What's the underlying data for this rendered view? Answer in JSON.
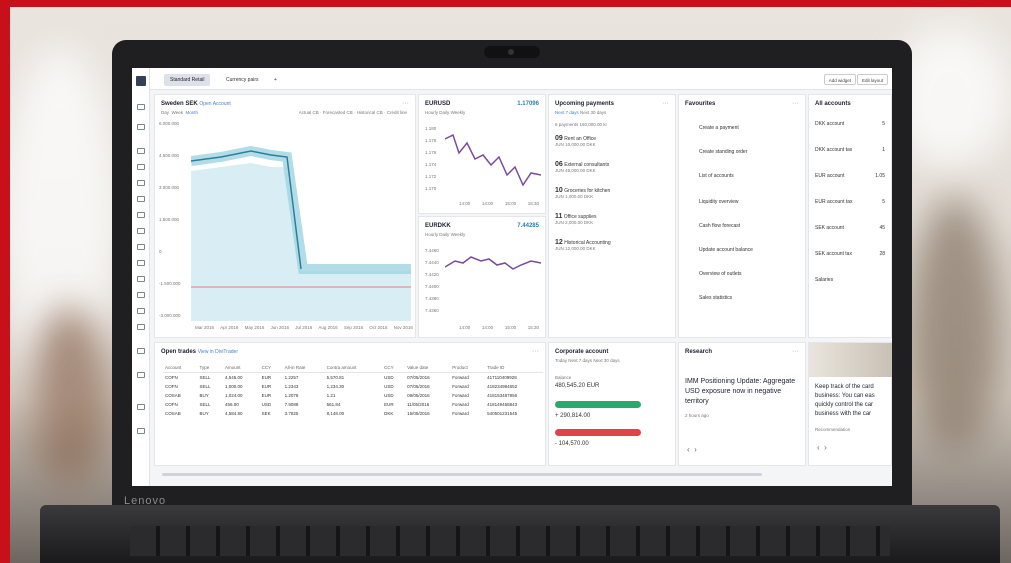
{
  "tabs": [
    {
      "label": "Standard Retail"
    },
    {
      "label": "Currency pairs"
    },
    {
      "label": "+"
    }
  ],
  "toolbar": {
    "add_widget": "Add widget",
    "edit_layout": "Edit layout"
  },
  "laptop": {
    "brand": "Lenovo"
  },
  "sweden": {
    "title": "Sweden SEK",
    "link": "Open Account",
    "tabs": [
      "Day",
      "Week",
      "Month"
    ],
    "legend": [
      "Actual CB",
      "Forecasted CB",
      "Historical CB",
      "Credit line"
    ],
    "y_ticks": [
      "6.000.000",
      "4.500.000",
      "3.000.000",
      "1.500.000",
      "0",
      "-1.500.000",
      "-3.000.000"
    ],
    "x_ticks": [
      "Mar 2016",
      "Apr 2016",
      "May 2016",
      "Jun 2016",
      "Jul 2016",
      "Aug 2016",
      "Sep 2016",
      "Oct 2016",
      "Nov 2016"
    ]
  },
  "eurusd": {
    "title": "EURUSD",
    "value": "1.17096",
    "tabs": [
      "Hourly",
      "Daily",
      "Weekly"
    ],
    "y_ticks": [
      "1.180",
      "1.178",
      "1.176",
      "1.174",
      "1.172",
      "1.170"
    ],
    "x_ticks": [
      "14:00",
      "14:00",
      "15:00",
      "15:30"
    ]
  },
  "eurdkk": {
    "title": "EURDKK",
    "value": "7.44285",
    "tabs": [
      "Hourly",
      "Daily",
      "Weekly"
    ],
    "y_ticks": [
      "7.4460",
      "7.4440",
      "7.4420",
      "7.4400",
      "7.4380",
      "7.4360"
    ],
    "x_ticks": [
      "14:00",
      "14:00",
      "15:00",
      "15:30"
    ]
  },
  "payments": {
    "title": "Upcoming payments",
    "tabs": [
      "Next 7 days",
      "Next 30 days"
    ],
    "summary": "6 payments   160,000.00 kr",
    "items": [
      {
        "day": "09",
        "month": "JUN",
        "name": "Rent an Office",
        "amount": "10,000.00 DKK"
      },
      {
        "day": "06",
        "month": "JUN",
        "name": "External consultants",
        "amount": "45,000.00 DKK"
      },
      {
        "day": "10",
        "month": "JUN",
        "name": "Groceries for kitchen",
        "amount": "1,000.00 DKK"
      },
      {
        "day": "11",
        "month": "JUN",
        "name": "Office supplies",
        "amount": "2,000.00 DKK"
      },
      {
        "day": "12",
        "month": "JUN",
        "name": "Historical Accounting",
        "amount": "12,000.00 DKK"
      }
    ]
  },
  "favourites": {
    "title": "Favourites",
    "items": [
      "Create a payment",
      "Create standing order",
      "List of accounts",
      "Liquidity overview",
      "Cash flow forecast",
      "Update account balance",
      "Overview of outlets",
      "Sales statistics"
    ]
  },
  "accounts": {
    "title": "All accounts",
    "items": [
      {
        "name": "DKK account",
        "amount": "5"
      },
      {
        "name": "DKK account tax",
        "amount": "1"
      },
      {
        "name": "EUR account",
        "amount": "1.05"
      },
      {
        "name": "EUR account tax",
        "amount": "5"
      },
      {
        "name": "SEK account",
        "amount": "45"
      },
      {
        "name": "SEK account tax",
        "amount": "28"
      },
      {
        "name": "Salaries",
        "amount": ""
      }
    ]
  },
  "trades": {
    "title": "Open trades",
    "link": "View in DiviTrader",
    "headers": [
      "Account",
      "Type",
      "Amount",
      "CCY",
      "All-in Rate",
      "Contra amount",
      "CCY",
      "Value date",
      "Product",
      "Trade ID"
    ],
    "rows": [
      [
        "COFN",
        "SELL",
        "4,545.00",
        "EUR",
        "1.2257",
        "5,570.81",
        "USD",
        "07/05/2016",
        "Forward",
        "417110409928"
      ],
      [
        "COFN",
        "SELL",
        "1,000.00",
        "EUR",
        "1.2343",
        "1,234.30",
        "USD",
        "07/05/2016",
        "Forward",
        "418234984652"
      ],
      [
        "COSAB",
        "BUY",
        "1,024.00",
        "EUR",
        "1.2078",
        "1.21",
        "USD",
        "09/05/2016",
        "Forward",
        "418153487856"
      ],
      [
        "COFN",
        "SELL",
        "456.00",
        "USD",
        "7.9088",
        "561.84",
        "EUR",
        "11/05/2016",
        "Forward",
        "418149458843"
      ],
      [
        "COSAB",
        "BUY",
        "4,584.80",
        "SEK",
        "3.7825",
        "8,148.00",
        "DKK",
        "15/05/2016",
        "Forward",
        "540501231545"
      ]
    ]
  },
  "corporate": {
    "title": "Corporate account",
    "tabs": [
      "Today",
      "Next 7 days",
      "Next 30 days"
    ],
    "balance_label": "Balance",
    "balance": "480,545.20 EUR",
    "positive": "+ 290,814.00",
    "negative": "- 104,570.00"
  },
  "research": {
    "title": "Research",
    "headline": "IMM Positioning Update: Aggregate USD exposure now in negative territory",
    "date": "2 hours ago"
  },
  "promo": {
    "text": "Keep track of the card business: You can eas quickly control the car business with the car",
    "meta": "Recommendation"
  },
  "colors": {
    "accent": "#4a7fd0",
    "teal": "#8ecfdc",
    "purple": "#7a4aa0",
    "green": "#2ea86a",
    "red": "#e0434c"
  }
}
